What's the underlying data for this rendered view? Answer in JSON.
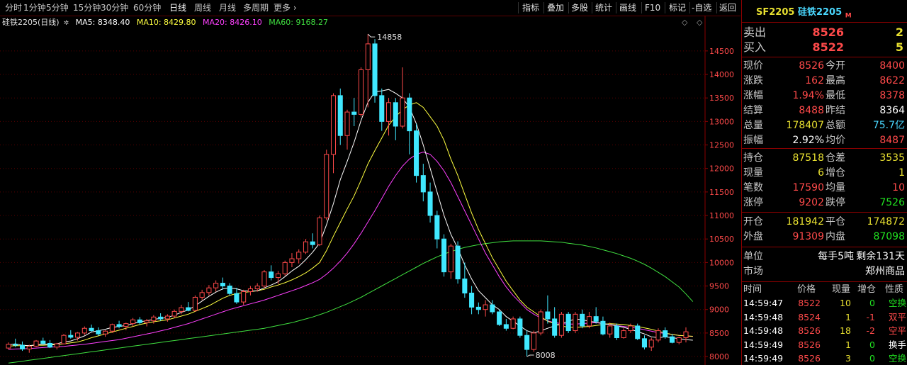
{
  "toolbar": {
    "periods": [
      "分时",
      "1分钟",
      "5分钟",
      "15分钟",
      "30分钟",
      "60分钟",
      "日线",
      "周线",
      "月线",
      "多周期",
      "更多"
    ],
    "active_period": "日线",
    "tools": [
      "指标",
      "叠加",
      "多股",
      "统计",
      "画线",
      "F10",
      "标记",
      "-自选",
      "返回"
    ]
  },
  "legend": {
    "symbol": "硅铁2205(日线)",
    "ma5": "MA5: 8348.40",
    "ma10": "MA10: 8429.80",
    "ma20": "MA20: 8426.10",
    "ma60": "MA60: 9168.27"
  },
  "colors": {
    "up": "#ff4a4a",
    "down": "#40e8ff",
    "ma5": "#ffffff",
    "ma10": "#ffff40",
    "ma20": "#ff40ff",
    "ma60": "#40e040",
    "grid": "#5a0000"
  },
  "chart_data": {
    "type": "candlestick",
    "y_ticks": [
      8000,
      8500,
      9000,
      9500,
      10000,
      10500,
      11000,
      11500,
      12000,
      12500,
      13000,
      13500,
      14000,
      14500
    ],
    "ylim": [
      7880,
      14950
    ],
    "high_label": "14858",
    "low_label": "8008",
    "ohlc": [
      [
        8180,
        8300,
        8150,
        8260
      ],
      [
        8260,
        8380,
        8200,
        8240
      ],
      [
        8240,
        8320,
        8120,
        8160
      ],
      [
        8160,
        8250,
        8080,
        8220
      ],
      [
        8220,
        8350,
        8200,
        8330
      ],
      [
        8330,
        8400,
        8250,
        8280
      ],
      [
        8280,
        8350,
        8180,
        8200
      ],
      [
        8200,
        8290,
        8150,
        8270
      ],
      [
        8270,
        8480,
        8260,
        8450
      ],
      [
        8450,
        8560,
        8380,
        8410
      ],
      [
        8410,
        8520,
        8340,
        8500
      ],
      [
        8500,
        8640,
        8460,
        8600
      ],
      [
        8600,
        8680,
        8520,
        8550
      ],
      [
        8550,
        8620,
        8440,
        8480
      ],
      [
        8480,
        8560,
        8420,
        8540
      ],
      [
        8540,
        8700,
        8500,
        8680
      ],
      [
        8680,
        8760,
        8600,
        8640
      ],
      [
        8640,
        8720,
        8560,
        8700
      ],
      [
        8700,
        8820,
        8640,
        8780
      ],
      [
        8780,
        8840,
        8680,
        8720
      ],
      [
        8720,
        8800,
        8640,
        8760
      ],
      [
        8760,
        8880,
        8700,
        8840
      ],
      [
        8840,
        8920,
        8760,
        8800
      ],
      [
        8800,
        8900,
        8740,
        8860
      ],
      [
        8860,
        9000,
        8820,
        8960
      ],
      [
        8960,
        9100,
        8900,
        9040
      ],
      [
        9040,
        9160,
        8960,
        8980
      ],
      [
        8980,
        9300,
        8950,
        9260
      ],
      [
        9260,
        9420,
        9200,
        9360
      ],
      [
        9360,
        9520,
        9300,
        9460
      ],
      [
        9460,
        9620,
        9380,
        9560
      ],
      [
        9560,
        9680,
        9420,
        9500
      ],
      [
        9500,
        9560,
        9300,
        9340
      ],
      [
        9340,
        9460,
        9120,
        9160
      ],
      [
        9160,
        9420,
        9100,
        9380
      ],
      [
        9380,
        9500,
        9300,
        9440
      ],
      [
        9440,
        9560,
        9380,
        9500
      ],
      [
        9500,
        9840,
        9460,
        9800
      ],
      [
        9800,
        9940,
        9620,
        9680
      ],
      [
        9680,
        9820,
        9540,
        9760
      ],
      [
        9760,
        10040,
        9720,
        10000
      ],
      [
        10000,
        10200,
        9900,
        10080
      ],
      [
        10080,
        10280,
        9980,
        10220
      ],
      [
        10220,
        10500,
        10180,
        10440
      ],
      [
        10440,
        10620,
        10300,
        10380
      ],
      [
        10380,
        11000,
        10350,
        10950
      ],
      [
        10950,
        12400,
        10900,
        12300
      ],
      [
        12300,
        13600,
        11900,
        13550
      ],
      [
        13550,
        13700,
        12500,
        12700
      ],
      [
        12700,
        13250,
        12400,
        13200
      ],
      [
        13200,
        13500,
        12900,
        13150
      ],
      [
        13150,
        14150,
        13100,
        14100
      ],
      [
        14100,
        14858,
        13300,
        14650
      ],
      [
        14650,
        14750,
        13400,
        13550
      ],
      [
        13550,
        13700,
        12800,
        13000
      ],
      [
        13000,
        13500,
        12700,
        13400
      ],
      [
        13400,
        13500,
        12600,
        12900
      ],
      [
        12900,
        14150,
        12850,
        13500
      ],
      [
        13500,
        13600,
        12300,
        12800
      ],
      [
        12800,
        12950,
        11700,
        11850
      ],
      [
        11850,
        12100,
        11300,
        11500
      ],
      [
        11500,
        11700,
        10850,
        11000
      ],
      [
        11000,
        11100,
        10300,
        10500
      ],
      [
        10500,
        10600,
        9700,
        9800
      ],
      [
        9800,
        10400,
        9650,
        10350
      ],
      [
        10350,
        10450,
        9550,
        9650
      ],
      [
        9650,
        10000,
        9250,
        9350
      ],
      [
        9350,
        9500,
        8900,
        9050
      ],
      [
        9050,
        9150,
        8900,
        9000
      ],
      [
        9000,
        9200,
        8850,
        9100
      ],
      [
        9100,
        9200,
        8900,
        8950
      ],
      [
        8950,
        9000,
        8650,
        8680
      ],
      [
        8680,
        8800,
        8550,
        8600
      ],
      [
        8600,
        8850,
        8580,
        8800
      ],
      [
        8800,
        8850,
        8400,
        8450
      ],
      [
        8450,
        8550,
        8000,
        8150
      ],
      [
        8150,
        8550,
        8100,
        8500
      ],
      [
        8500,
        9000,
        8450,
        8950
      ],
      [
        8950,
        9300,
        8700,
        8800
      ],
      [
        8800,
        9050,
        8400,
        8450
      ],
      [
        8450,
        8950,
        8400,
        8900
      ],
      [
        8900,
        8950,
        8500,
        8550
      ],
      [
        8550,
        8950,
        8500,
        8900
      ],
      [
        8900,
        9000,
        8600,
        8650
      ],
      [
        8650,
        8950,
        8600,
        8850
      ],
      [
        8850,
        9050,
        8700,
        8750
      ],
      [
        8750,
        8850,
        8450,
        8480
      ],
      [
        8480,
        8720,
        8400,
        8650
      ],
      [
        8650,
        8700,
        8350,
        8400
      ],
      [
        8400,
        8600,
        8380,
        8550
      ],
      [
        8550,
        8700,
        8500,
        8650
      ],
      [
        8650,
        8700,
        8350,
        8380
      ],
      [
        8380,
        8450,
        8150,
        8200
      ],
      [
        8200,
        8400,
        8120,
        8350
      ],
      [
        8350,
        8600,
        8300,
        8550
      ],
      [
        8550,
        8620,
        8380,
        8420
      ],
      [
        8420,
        8480,
        8280,
        8300
      ],
      [
        8300,
        8420,
        8260,
        8400
      ],
      [
        8400,
        8620,
        8300,
        8526
      ]
    ],
    "ma_lines": {
      "ma5": [
        8250,
        8270,
        8240,
        8230,
        8250,
        8260,
        8260,
        8270,
        8310,
        8330,
        8380,
        8440,
        8520,
        8550,
        8580,
        8620,
        8640,
        8660,
        8700,
        8740,
        8760,
        8790,
        8810,
        8830,
        8880,
        8940,
        8990,
        9080,
        9180,
        9280,
        9370,
        9440,
        9460,
        9440,
        9400,
        9390,
        9400,
        9460,
        9520,
        9590,
        9700,
        9820,
        9920,
        10060,
        10220,
        10410,
        10800,
        11250,
        11760,
        12150,
        12560,
        13020,
        13410,
        13630,
        13650,
        13680,
        13600,
        13500,
        13300,
        12950,
        12500,
        12000,
        11500,
        11000,
        10600,
        10300,
        9950,
        9650,
        9400,
        9250,
        9100,
        9000,
        8850,
        8750,
        8650,
        8550,
        8500,
        8550,
        8600,
        8650,
        8700,
        8750,
        8800,
        8780,
        8750,
        8730,
        8700,
        8680,
        8650,
        8620,
        8580,
        8530,
        8480,
        8420,
        8400,
        8420,
        8400,
        8380,
        8360,
        8348
      ],
      "ma10": [
        8220,
        8230,
        8230,
        8230,
        8240,
        8240,
        8250,
        8250,
        8270,
        8290,
        8310,
        8350,
        8400,
        8440,
        8480,
        8520,
        8560,
        8600,
        8640,
        8680,
        8710,
        8740,
        8760,
        8780,
        8820,
        8860,
        8900,
        8960,
        9020,
        9080,
        9160,
        9240,
        9300,
        9340,
        9360,
        9380,
        9400,
        9430,
        9480,
        9520,
        9570,
        9630,
        9700,
        9780,
        9880,
        10000,
        10250,
        10560,
        10850,
        11140,
        11420,
        11750,
        12100,
        12380,
        12650,
        12920,
        13100,
        13250,
        13350,
        13400,
        13300,
        13100,
        12900,
        12600,
        12200,
        11850,
        11450,
        11050,
        10700,
        10400,
        10100,
        9850,
        9600,
        9400,
        9200,
        9050,
        8950,
        8850,
        8750,
        8700,
        8650,
        8620,
        8620,
        8630,
        8640,
        8660,
        8680,
        8700,
        8690,
        8680,
        8660,
        8640,
        8610,
        8580,
        8540,
        8500,
        8470,
        8450,
        8440,
        8430
      ],
      "ma20": [
        8150,
        8160,
        8165,
        8170,
        8180,
        8190,
        8200,
        8205,
        8215,
        8230,
        8245,
        8260,
        8280,
        8300,
        8320,
        8340,
        8360,
        8390,
        8420,
        8450,
        8480,
        8510,
        8545,
        8580,
        8620,
        8660,
        8700,
        8750,
        8800,
        8850,
        8900,
        8950,
        9000,
        9040,
        9080,
        9120,
        9160,
        9200,
        9250,
        9300,
        9350,
        9400,
        9450,
        9510,
        9570,
        9640,
        9750,
        9880,
        10030,
        10200,
        10400,
        10620,
        10860,
        11100,
        11360,
        11620,
        11850,
        12050,
        12200,
        12300,
        12350,
        12300,
        12150,
        11950,
        11700,
        11400,
        11100,
        10800,
        10500,
        10200,
        9950,
        9700,
        9480,
        9300,
        9150,
        9000,
        8900,
        8820,
        8760,
        8720,
        8700,
        8690,
        8690,
        8700,
        8710,
        8720,
        8700,
        8680,
        8660,
        8640,
        8620,
        8600,
        8570,
        8540,
        8510,
        8490,
        8470,
        8450,
        8440,
        8426
      ],
      "ma60": [
        7860,
        7880,
        7900,
        7920,
        7940,
        7960,
        7980,
        8000,
        8020,
        8040,
        8060,
        8080,
        8100,
        8120,
        8140,
        8160,
        8180,
        8200,
        8220,
        8240,
        8260,
        8280,
        8300,
        8320,
        8340,
        8360,
        8380,
        8400,
        8420,
        8440,
        8460,
        8480,
        8500,
        8520,
        8540,
        8560,
        8580,
        8600,
        8630,
        8660,
        8690,
        8720,
        8760,
        8800,
        8840,
        8890,
        8940,
        9000,
        9060,
        9120,
        9190,
        9260,
        9340,
        9420,
        9500,
        9580,
        9660,
        9740,
        9820,
        9900,
        9980,
        10050,
        10120,
        10180,
        10230,
        10280,
        10320,
        10350,
        10380,
        10400,
        10420,
        10440,
        10450,
        10460,
        10460,
        10460,
        10460,
        10460,
        10450,
        10440,
        10430,
        10410,
        10390,
        10370,
        10340,
        10310,
        10270,
        10230,
        10190,
        10140,
        10090,
        10030,
        9960,
        9880,
        9790,
        9700,
        9590,
        9480,
        9330,
        9168
      ]
    }
  },
  "panel": {
    "header": {
      "code": "SF2205",
      "name": "硅铁2205",
      "badge": "M"
    },
    "sell": {
      "label": "卖出",
      "price": "8526",
      "vol": "2"
    },
    "buy": {
      "label": "买入",
      "price": "8522",
      "vol": "5"
    },
    "quote_rows": [
      {
        "l1": "现价",
        "v1": "8526",
        "c1": "red",
        "l2": "今开",
        "v2": "8400",
        "c2": "red"
      },
      {
        "l1": "涨跌",
        "v1": "162",
        "c1": "red",
        "l2": "最高",
        "v2": "8622",
        "c2": "red"
      },
      {
        "l1": "涨幅",
        "v1": "1.94%",
        "c1": "red",
        "l2": "最低",
        "v2": "8378",
        "c2": "red"
      },
      {
        "l1": "结算",
        "v1": "8488",
        "c1": "red",
        "l2": "昨结",
        "v2": "8364",
        "c2": "wht"
      },
      {
        "l1": "总量",
        "v1": "178407",
        "c1": "yel",
        "l2": "总额",
        "v2": "75.7亿",
        "c2": "cyan"
      },
      {
        "l1": "振幅",
        "v1": "2.92%",
        "c1": "wht",
        "l2": "均价",
        "v2": "8487",
        "c2": "red"
      }
    ],
    "pos_rows": [
      {
        "l1": "持仓",
        "v1": "87518",
        "c1": "yel",
        "l2": "仓差",
        "v2": "3535",
        "c2": "yel"
      },
      {
        "l1": "现量",
        "v1": "6",
        "c1": "yel",
        "l2": "增仓",
        "v2": "1",
        "c2": "yel"
      },
      {
        "l1": "笔数",
        "v1": "17590",
        "c1": "red",
        "l2": "均量",
        "v2": "10",
        "c2": "red"
      },
      {
        "l1": "涨停",
        "v1": "9202",
        "c1": "red",
        "l2": "跌停",
        "v2": "7526",
        "c2": "grn"
      }
    ],
    "oc_rows": [
      {
        "l1": "开仓",
        "v1": "181942",
        "c1": "yel",
        "l2": "平仓",
        "v2": "174872",
        "c2": "yel"
      },
      {
        "l1": "外盘",
        "v1": "91309",
        "c1": "red",
        "l2": "内盘",
        "v2": "87098",
        "c2": "grn"
      }
    ],
    "unit": {
      "label": "单位",
      "value": "每手5吨",
      "extra": "剩余131天"
    },
    "market": {
      "label": "市场",
      "value": "郑州商品"
    },
    "ticks_header": [
      "时间",
      "价格",
      "现量",
      "增仓",
      "性质"
    ],
    "ticks": [
      {
        "time": "14:59:47",
        "price": "8522",
        "vol": "10",
        "chg": "0",
        "type": "空换",
        "chg_c": "grn",
        "type_c": "grn"
      },
      {
        "time": "14:59:48",
        "price": "8524",
        "vol": "1",
        "chg": "-1",
        "type": "双平",
        "chg_c": "red",
        "type_c": "red"
      },
      {
        "time": "14:59:48",
        "price": "8526",
        "vol": "18",
        "chg": "-2",
        "type": "空平",
        "chg_c": "red",
        "type_c": "red"
      },
      {
        "time": "14:59:49",
        "price": "8526",
        "vol": "1",
        "chg": "0",
        "type": "换手",
        "chg_c": "grn",
        "type_c": "wht"
      },
      {
        "time": "14:59:49",
        "price": "8526",
        "vol": "3",
        "chg": "0",
        "type": "空换",
        "chg_c": "grn",
        "type_c": "grn"
      }
    ]
  },
  "icons": {
    "scroll_up": "◇",
    "scroll_side": "◇"
  }
}
